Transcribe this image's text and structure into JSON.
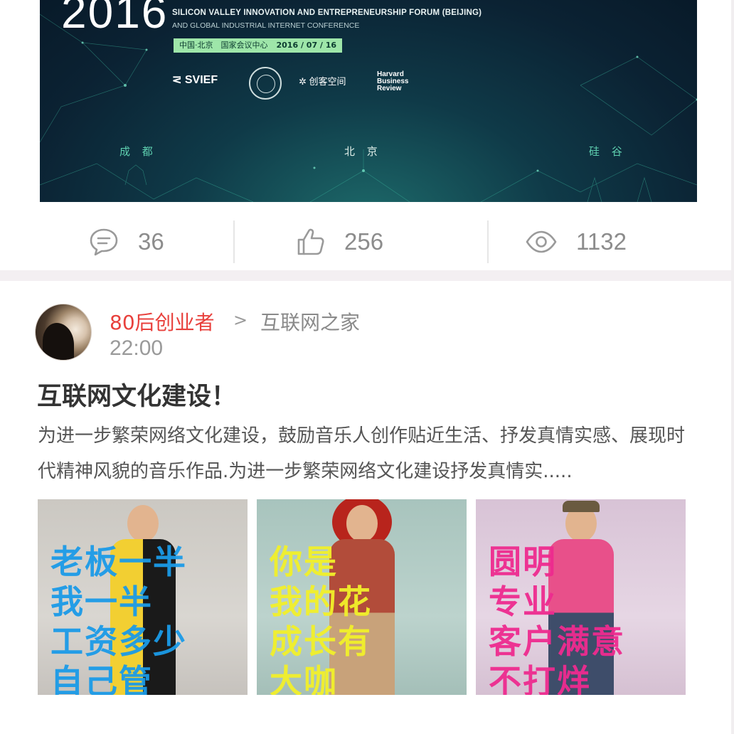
{
  "banner": {
    "year": "2016",
    "forum_line": "SILICON VALLEY INNOVATION AND ENTREPRENEURSHIP FORUM (BEIJING)",
    "conference_line": "AND GLOBAL INDUSTRIAL INTERNET CONFERENCE",
    "venue": "中国·北京　国家会议中心",
    "date": "2016 / 07 / 16",
    "logos": {
      "svief": "SVIEF",
      "makerspace": "创客空间",
      "hbr": "Harvard Business Review"
    },
    "cities": [
      "成 都",
      "北 京",
      "硅 谷"
    ]
  },
  "stats": {
    "comments": "36",
    "likes": "256",
    "views": "1132"
  },
  "post": {
    "author": "80后创业者",
    "separator": ">",
    "circle": "互联网之家",
    "time": "22:00",
    "title": "互联网文化建设！",
    "excerpt": "为进一步繁荣网络文化建设，鼓励音乐人创作贴近生活、抒发真情实感、展现时代精神风貌的音乐作品.为进一步繁荣网络文化建设抒发真情实.....",
    "posters": [
      {
        "text": "老板一半\n我一半\n工资多少\n自己管"
      },
      {
        "text": "你是\n我的花\n成长有\n大咖"
      },
      {
        "text": "圆明\n专业\n客户满意\n不打烊"
      }
    ]
  },
  "colors": {
    "author": "#e8403c",
    "muted": "#9a9a9a",
    "divider": "#f3eff2"
  },
  "icons": [
    "comment-icon",
    "thumbs-up-icon",
    "eye-icon"
  ]
}
